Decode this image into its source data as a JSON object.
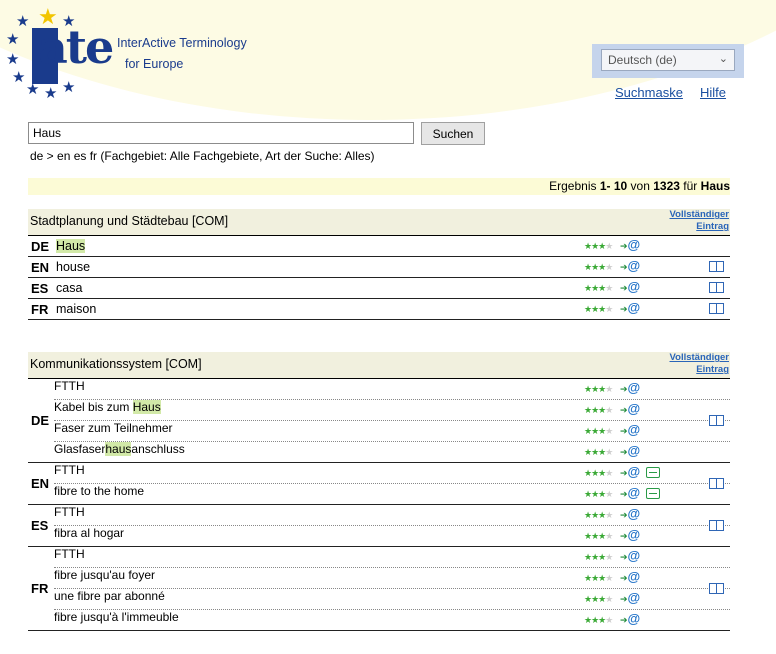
{
  "app": {
    "brand_line1": "InterActive Terminology",
    "brand_line2": "for Europe",
    "logo_text": "ate",
    "language_select": "Deutsch (de)"
  },
  "nav": {
    "search_mask": "Suchmaske",
    "help": "Hilfe"
  },
  "search": {
    "value": "Haus",
    "button": "Suchen",
    "info": "de > en es fr (Fachgebiet: Alle Fachgebiete, Art der Suche: Alles)"
  },
  "results": {
    "prefix": "Ergebnis",
    "range": "1- 10",
    "of": "von",
    "total": "1323",
    "for": "für",
    "term": "Haus"
  },
  "labels": {
    "full_entry_1": "Vollständiger",
    "full_entry_2": "Eintrag"
  },
  "entry1": {
    "domain": "Stadtplanung und Städtebau [COM]",
    "rows": [
      {
        "lang": "DE",
        "pre": "",
        "hl": "Haus",
        "post": ""
      },
      {
        "lang": "EN",
        "pre": "house",
        "hl": "",
        "post": ""
      },
      {
        "lang": "ES",
        "pre": "casa",
        "hl": "",
        "post": ""
      },
      {
        "lang": "FR",
        "pre": "maison",
        "hl": "",
        "post": ""
      }
    ]
  },
  "entry2": {
    "domain": "Kommunikationssystem [COM]",
    "groups": [
      {
        "lang": "DE",
        "terms": [
          {
            "pre": "FTTH",
            "hl": "",
            "post": ""
          },
          {
            "pre": "Kabel bis zum ",
            "hl": "Haus",
            "post": ""
          },
          {
            "pre": "Faser zum Teilnehmer",
            "hl": "",
            "post": ""
          },
          {
            "pre": "Glasfaser",
            "hl": "haus",
            "post": "anschluss"
          }
        ]
      },
      {
        "lang": "EN",
        "terms": [
          {
            "pre": "FTTH",
            "hl": "",
            "post": ""
          },
          {
            "pre": "fibre to the home",
            "hl": "",
            "post": ""
          }
        ]
      },
      {
        "lang": "ES",
        "terms": [
          {
            "pre": "FTTH",
            "hl": "",
            "post": ""
          },
          {
            "pre": "fibra al hogar",
            "hl": "",
            "post": ""
          }
        ]
      },
      {
        "lang": "FR",
        "terms": [
          {
            "pre": "FTTH",
            "hl": "",
            "post": ""
          },
          {
            "pre": "fibre jusqu'au foyer",
            "hl": "",
            "post": ""
          },
          {
            "pre": "une fibre par abonné",
            "hl": "",
            "post": ""
          },
          {
            "pre": "fibre jusqu'à l'immeuble",
            "hl": "",
            "post": ""
          }
        ]
      }
    ]
  },
  "reliability": {
    "filled": 3,
    "max": 4
  },
  "colors": {
    "brand_blue": "#1a3b8c",
    "highlight": "#d2e9a8",
    "link": "#1a4fa0"
  }
}
